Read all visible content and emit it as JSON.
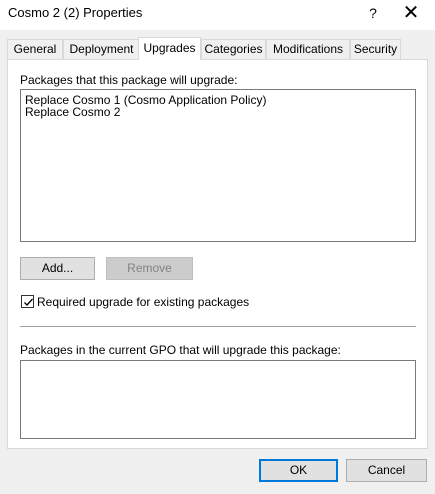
{
  "window": {
    "title": "Cosmo 2 (2) Properties",
    "help_label": "?",
    "close_label": "✕"
  },
  "tabs": [
    {
      "label": "General"
    },
    {
      "label": "Deployment"
    },
    {
      "label": "Upgrades"
    },
    {
      "label": "Categories"
    },
    {
      "label": "Modifications"
    },
    {
      "label": "Security"
    }
  ],
  "active_tab": "Upgrades",
  "upgrades": {
    "list_label": "Packages that this package will upgrade:",
    "items": [
      "Replace  Cosmo 1 (Cosmo Application Policy)",
      "Replace  Cosmo 2"
    ],
    "add_label": "Add...",
    "remove_label": "Remove",
    "required_label": "Required upgrade for existing packages",
    "required_checked": true,
    "gpo_label": "Packages in the current GPO that will upgrade this package:",
    "gpo_items": []
  },
  "footer": {
    "ok_label": "OK",
    "cancel_label": "Cancel"
  }
}
